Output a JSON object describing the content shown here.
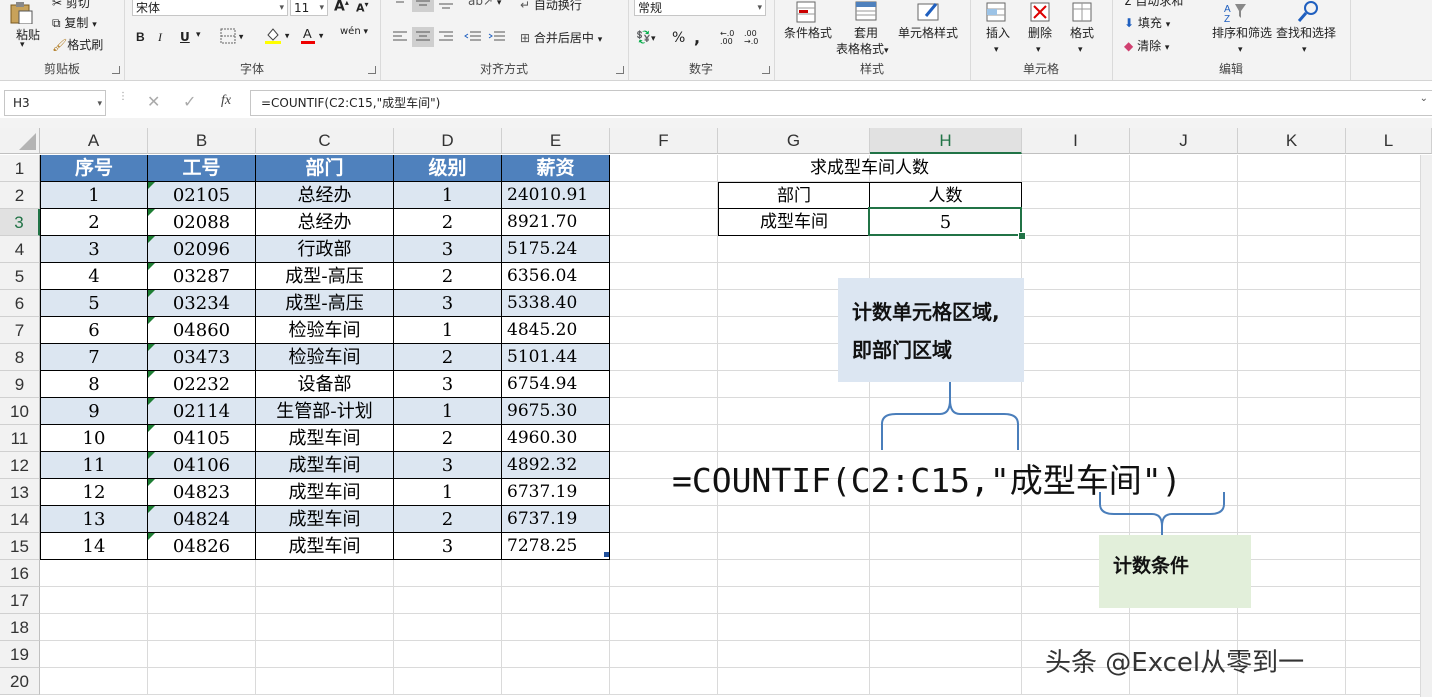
{
  "ribbon": {
    "clipboard": {
      "paste": "粘贴",
      "cut": "剪切",
      "copy": "复制",
      "format_painter": "格式刷",
      "label": "剪贴板"
    },
    "font": {
      "font_name": "宋体",
      "font_size": "11",
      "bold": "B",
      "italic": "I",
      "underline": "U",
      "phonetic": "wén",
      "label": "字体",
      "grow": "A",
      "shrink": "A"
    },
    "alignment": {
      "wrap_text": "自动换行",
      "merge_center": "合并后居中",
      "label": "对齐方式"
    },
    "number": {
      "format": "常规",
      "percent": "%",
      "comma": ",",
      "label": "数字"
    },
    "styles": {
      "conditional": "条件格式",
      "table_format_1": "套用",
      "table_format_2": "表格格式",
      "cell_styles": "单元格样式",
      "label": "样式"
    },
    "cells": {
      "insert": "插入",
      "delete": "删除",
      "format": "格式",
      "label": "单元格"
    },
    "editing": {
      "autosum": "自动求和",
      "fill": "填充",
      "clear": "清除",
      "sort_filter": "排序和筛选",
      "find_select": "查找和选择",
      "label": "编辑"
    }
  },
  "formula_bar": {
    "name_box": "H3",
    "fx": "fx",
    "formula": "=COUNTIF(C2:C15,\"成型车间\")"
  },
  "columns": [
    "A",
    "B",
    "C",
    "D",
    "E",
    "F",
    "G",
    "H",
    "I",
    "J",
    "K",
    "L"
  ],
  "rows": [
    "1",
    "2",
    "3",
    "4",
    "5",
    "6",
    "7",
    "8",
    "9",
    "10",
    "11",
    "12",
    "13",
    "14",
    "15",
    "16",
    "17",
    "18",
    "19",
    "20"
  ],
  "table": {
    "headers": [
      "序号",
      "工号",
      "部门",
      "级别",
      "薪资"
    ],
    "rows": [
      [
        "1",
        "02105",
        "总经办",
        "1",
        "24010.91"
      ],
      [
        "2",
        "02088",
        "总经办",
        "2",
        "8921.70"
      ],
      [
        "3",
        "02096",
        "行政部",
        "3",
        "5175.24"
      ],
      [
        "4",
        "03287",
        "成型-高压",
        "2",
        "6356.04"
      ],
      [
        "5",
        "03234",
        "成型-高压",
        "3",
        "5338.40"
      ],
      [
        "6",
        "04860",
        "检验车间",
        "1",
        "4845.20"
      ],
      [
        "7",
        "03473",
        "检验车间",
        "2",
        "5101.44"
      ],
      [
        "8",
        "02232",
        "设备部",
        "3",
        "6754.94"
      ],
      [
        "9",
        "02114",
        "生管部-计划",
        "1",
        "9675.30"
      ],
      [
        "10",
        "04105",
        "成型车间",
        "2",
        "4960.30"
      ],
      [
        "11",
        "04106",
        "成型车间",
        "3",
        "4892.32"
      ],
      [
        "12",
        "04823",
        "成型车间",
        "1",
        "6737.19"
      ],
      [
        "13",
        "04824",
        "成型车间",
        "2",
        "6737.19"
      ],
      [
        "14",
        "04826",
        "成型车间",
        "3",
        "7278.25"
      ]
    ]
  },
  "summary": {
    "title": "求成型车间人数",
    "col1": "部门",
    "col2": "人数",
    "dept": "成型车间",
    "count": "5"
  },
  "annotations": {
    "range_note_1": "计数单元格区域,",
    "range_note_2": "即部门区域",
    "formula_display": "=COUNTIF(C2:C15,\"成型车间\")",
    "criteria_note": "计数条件"
  },
  "watermark": "头条 @Excel从零到一",
  "colors": {
    "header_blue": "#4f81bd",
    "band_blue": "#dce6f1",
    "excel_green": "#217346",
    "note_blue": "#dce6f2",
    "note_green": "#e2efda",
    "brace": "#4a7ebb"
  }
}
